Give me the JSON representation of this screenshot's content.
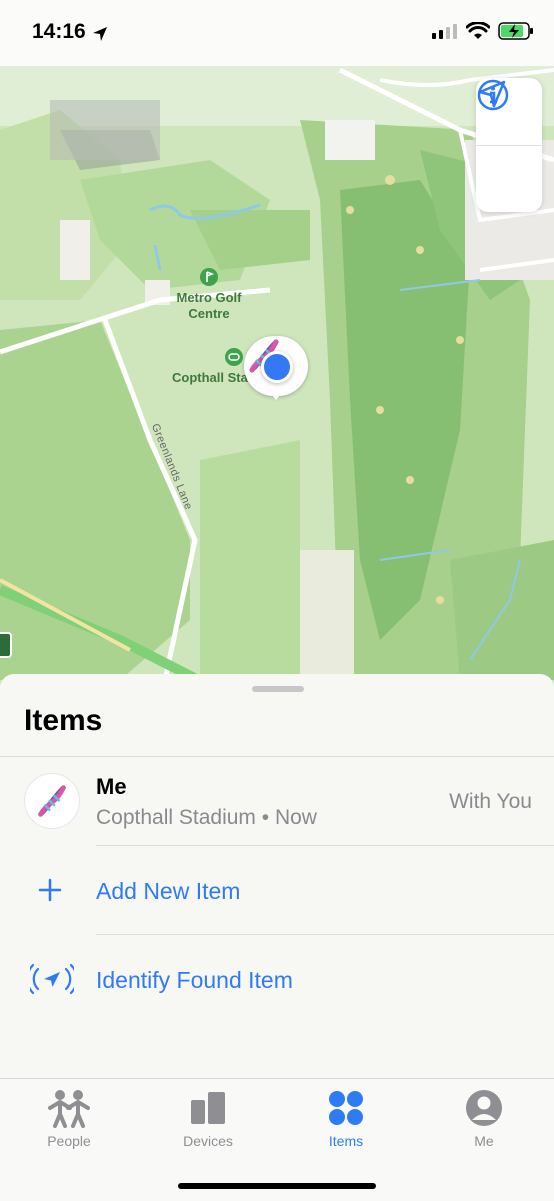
{
  "status_bar": {
    "time": "14:16"
  },
  "map": {
    "labels": {
      "golf_centre": "Metro Golf\nCentre",
      "stadium": "Copthall Stadium",
      "road": "Greenlands Lane"
    }
  },
  "sheet": {
    "title": "Items",
    "items": [
      {
        "name": "Me",
        "location": "Copthall Stadium",
        "time": "Now",
        "status": "With You",
        "icon": "dna-emoji"
      }
    ],
    "actions": [
      {
        "label": "Add New Item",
        "icon": "plus-icon"
      },
      {
        "label": "Identify Found Item",
        "icon": "location-waves-icon"
      }
    ]
  },
  "tab_bar": {
    "tabs": [
      {
        "label": "People",
        "icon": "people-icon",
        "active": false
      },
      {
        "label": "Devices",
        "icon": "devices-icon",
        "active": false
      },
      {
        "label": "Items",
        "icon": "items-icon",
        "active": true
      },
      {
        "label": "Me",
        "icon": "person-circle-icon",
        "active": false
      }
    ]
  },
  "colors": {
    "accent": "#2f7bf5",
    "map_green": "#bfe0a8",
    "user_dot": "#3478f6"
  }
}
